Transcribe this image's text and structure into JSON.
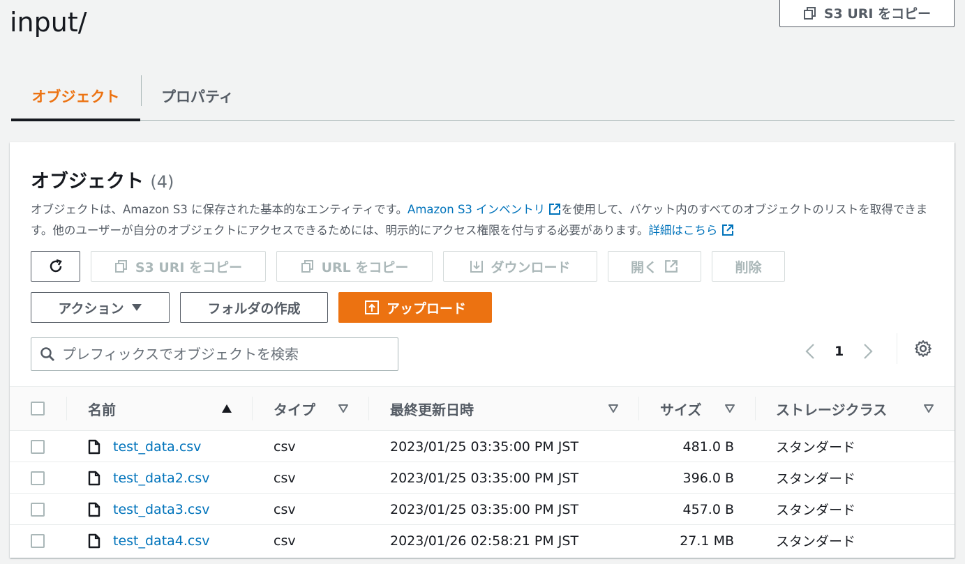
{
  "page": {
    "title": "input/",
    "copy_s3_uri_label": "S3 URI をコピー"
  },
  "tabs": [
    {
      "label": "オブジェクト",
      "active": true
    },
    {
      "label": "プロパティ",
      "active": false
    }
  ],
  "panel": {
    "title": "オブジェクト",
    "count": "(4)",
    "desc_part1": "オブジェクトは、Amazon S3 に保存された基本的なエンティティです。",
    "desc_link1": "Amazon S3 インベントリ",
    "desc_part2": "を使用して、バケット内のすべてのオブジェクトのリストを取得できます。他のユーザーが自分のオブジェクトにアクセスできるためには、明示的にアクセス権限を付与する必要があります。",
    "desc_link2": "詳細はこちら"
  },
  "toolbar": {
    "copy_s3_uri": "S3 URI をコピー",
    "copy_url": "URL をコピー",
    "download": "ダウンロード",
    "open": "開く",
    "delete": "削除",
    "actions": "アクション",
    "create_folder": "フォルダの作成",
    "upload": "アップロード"
  },
  "search": {
    "placeholder": "プレフィックスでオブジェクトを検索"
  },
  "pagination": {
    "current_page": "1"
  },
  "table": {
    "columns": {
      "name": "名前",
      "type": "タイプ",
      "modified": "最終更新日時",
      "size": "サイズ",
      "storage": "ストレージクラス"
    },
    "rows": [
      {
        "name": "test_data.csv",
        "type": "csv",
        "modified": "2023/01/25 03:35:00 PM JST",
        "size": "481.0 B",
        "storage": "スタンダード"
      },
      {
        "name": "test_data2.csv",
        "type": "csv",
        "modified": "2023/01/25 03:35:00 PM JST",
        "size": "396.0 B",
        "storage": "スタンダード"
      },
      {
        "name": "test_data3.csv",
        "type": "csv",
        "modified": "2023/01/25 03:35:00 PM JST",
        "size": "457.0 B",
        "storage": "スタンダード"
      },
      {
        "name": "test_data4.csv",
        "type": "csv",
        "modified": "2023/01/26 02:58:21 PM JST",
        "size": "27.1 MB",
        "storage": "スタンダード"
      }
    ]
  },
  "colors": {
    "accent": "#ec7211",
    "link": "#0073bb",
    "text": "#16191f",
    "muted": "#545b64",
    "disabled": "#aab7b8",
    "background": "#f2f3f3"
  }
}
